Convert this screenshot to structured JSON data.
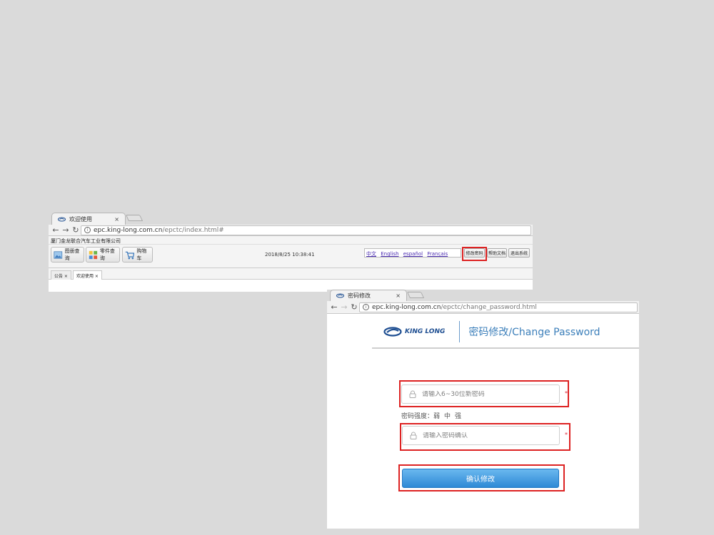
{
  "window1": {
    "tab_title": "欢迎使用",
    "tab_close": "×",
    "url_domain": "epc.king-long.com.cn",
    "url_path": "/epctc/index.html#",
    "company_name": "厦门金龙联合汽车工业有限公司",
    "toolbar": {
      "drawing_query": "图册查询",
      "parts_query": "零件查询",
      "cart": "购物车"
    },
    "datetime": "2018/8/25 10:38:41",
    "languages": [
      "中文",
      "English",
      "español",
      "Français"
    ],
    "buttons": {
      "change_password": "修改密码",
      "help_docs": "帮助文档",
      "logout": "退出系统"
    },
    "page_tabs": [
      {
        "label": "公告 ×"
      },
      {
        "label": "欢迎使用 ×"
      }
    ]
  },
  "window2": {
    "tab_title": "密码修改",
    "tab_close": "×",
    "url_domain": "epc.king-long.com.cn",
    "url_path": "/epctc/change_password.html",
    "logo_text": "KING LONG",
    "page_title": "密码修改/Change Password",
    "new_password_placeholder": "请输入6~30位新密码",
    "confirm_password_placeholder": "请输入密码确认",
    "required_mark": "*",
    "strength_label": "密码强度：",
    "strength_levels": [
      "弱",
      "中",
      "强"
    ],
    "submit_label": "确认修改"
  },
  "colors": {
    "background": "#dadada",
    "accent_blue": "#3c7fba",
    "button_blue": "#2e89d6",
    "highlight_red": "#dd2222",
    "logo_blue": "#1f4f92"
  }
}
